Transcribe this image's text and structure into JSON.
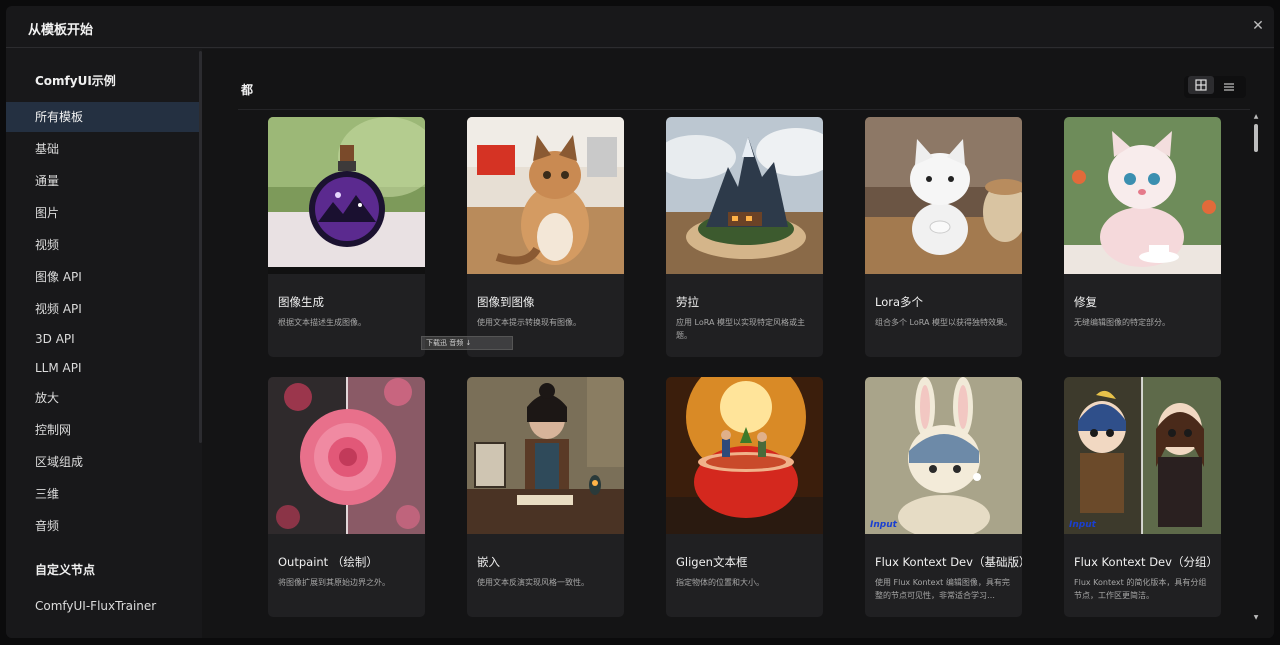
{
  "dialog": {
    "title": "从模板开始",
    "close_icon": "close-icon"
  },
  "sidebar": {
    "section1": "ComfyUI示例",
    "items": [
      "所有模板",
      "基础",
      "通量",
      "图片",
      "视频",
      "图像 API",
      "视频 API",
      "3D API",
      "LLM API",
      "放大",
      "控制网",
      "区域组成",
      "三维",
      "音频"
    ],
    "active_index": 0,
    "section2": "自定义节点",
    "custom_items": [
      "ComfyUI-FluxTrainer"
    ]
  },
  "main": {
    "category_title": "都",
    "view_toggle": {
      "grid_icon": "grid-icon",
      "list_icon": "list-icon",
      "active": "grid"
    },
    "cards": [
      {
        "title": "图像生成",
        "desc": "根据文本描述生成图像。",
        "thumb": "bottle-galaxy"
      },
      {
        "title": "图像到图像",
        "desc": "使用文本提示转换现有图像。",
        "thumb": "cat"
      },
      {
        "title": "劳拉",
        "desc": "应用 LoRA 模型以实现特定风格或主题。",
        "thumb": "mountain-village"
      },
      {
        "title": "Lora多个",
        "desc": "组合多个 LoRA 模型以获得独特效果。",
        "thumb": "white-cat-figurine"
      },
      {
        "title": "修复",
        "desc": "无缝编辑图像的特定部分。",
        "thumb": "fluffy-cat-tea"
      },
      {
        "title": "Outpaint （绘制）",
        "desc": "将图像扩展到其原始边界之外。",
        "thumb": "rose"
      },
      {
        "title": "嵌入",
        "desc": "使用文本反演实现风格一致性。",
        "thumb": "woman-desk"
      },
      {
        "title": "Gligen文本框",
        "desc": "指定物体的位置和大小。",
        "thumb": "tomato-figures"
      },
      {
        "title": "Flux Kontext Dev（基础版）",
        "desc": "使用 Flux Kontext 编辑图像，具有完整的节点可见性，非常适合学习…",
        "thumb": "bunny-pearl",
        "badge": "Input"
      },
      {
        "title": "Flux Kontext Dev（分组）",
        "desc": "Flux Kontext 的简化版本，具有分组节点，工作区更简洁。",
        "thumb": "dolls",
        "badge": "Input"
      }
    ],
    "watermark": "下载迅 音频 ↓"
  }
}
